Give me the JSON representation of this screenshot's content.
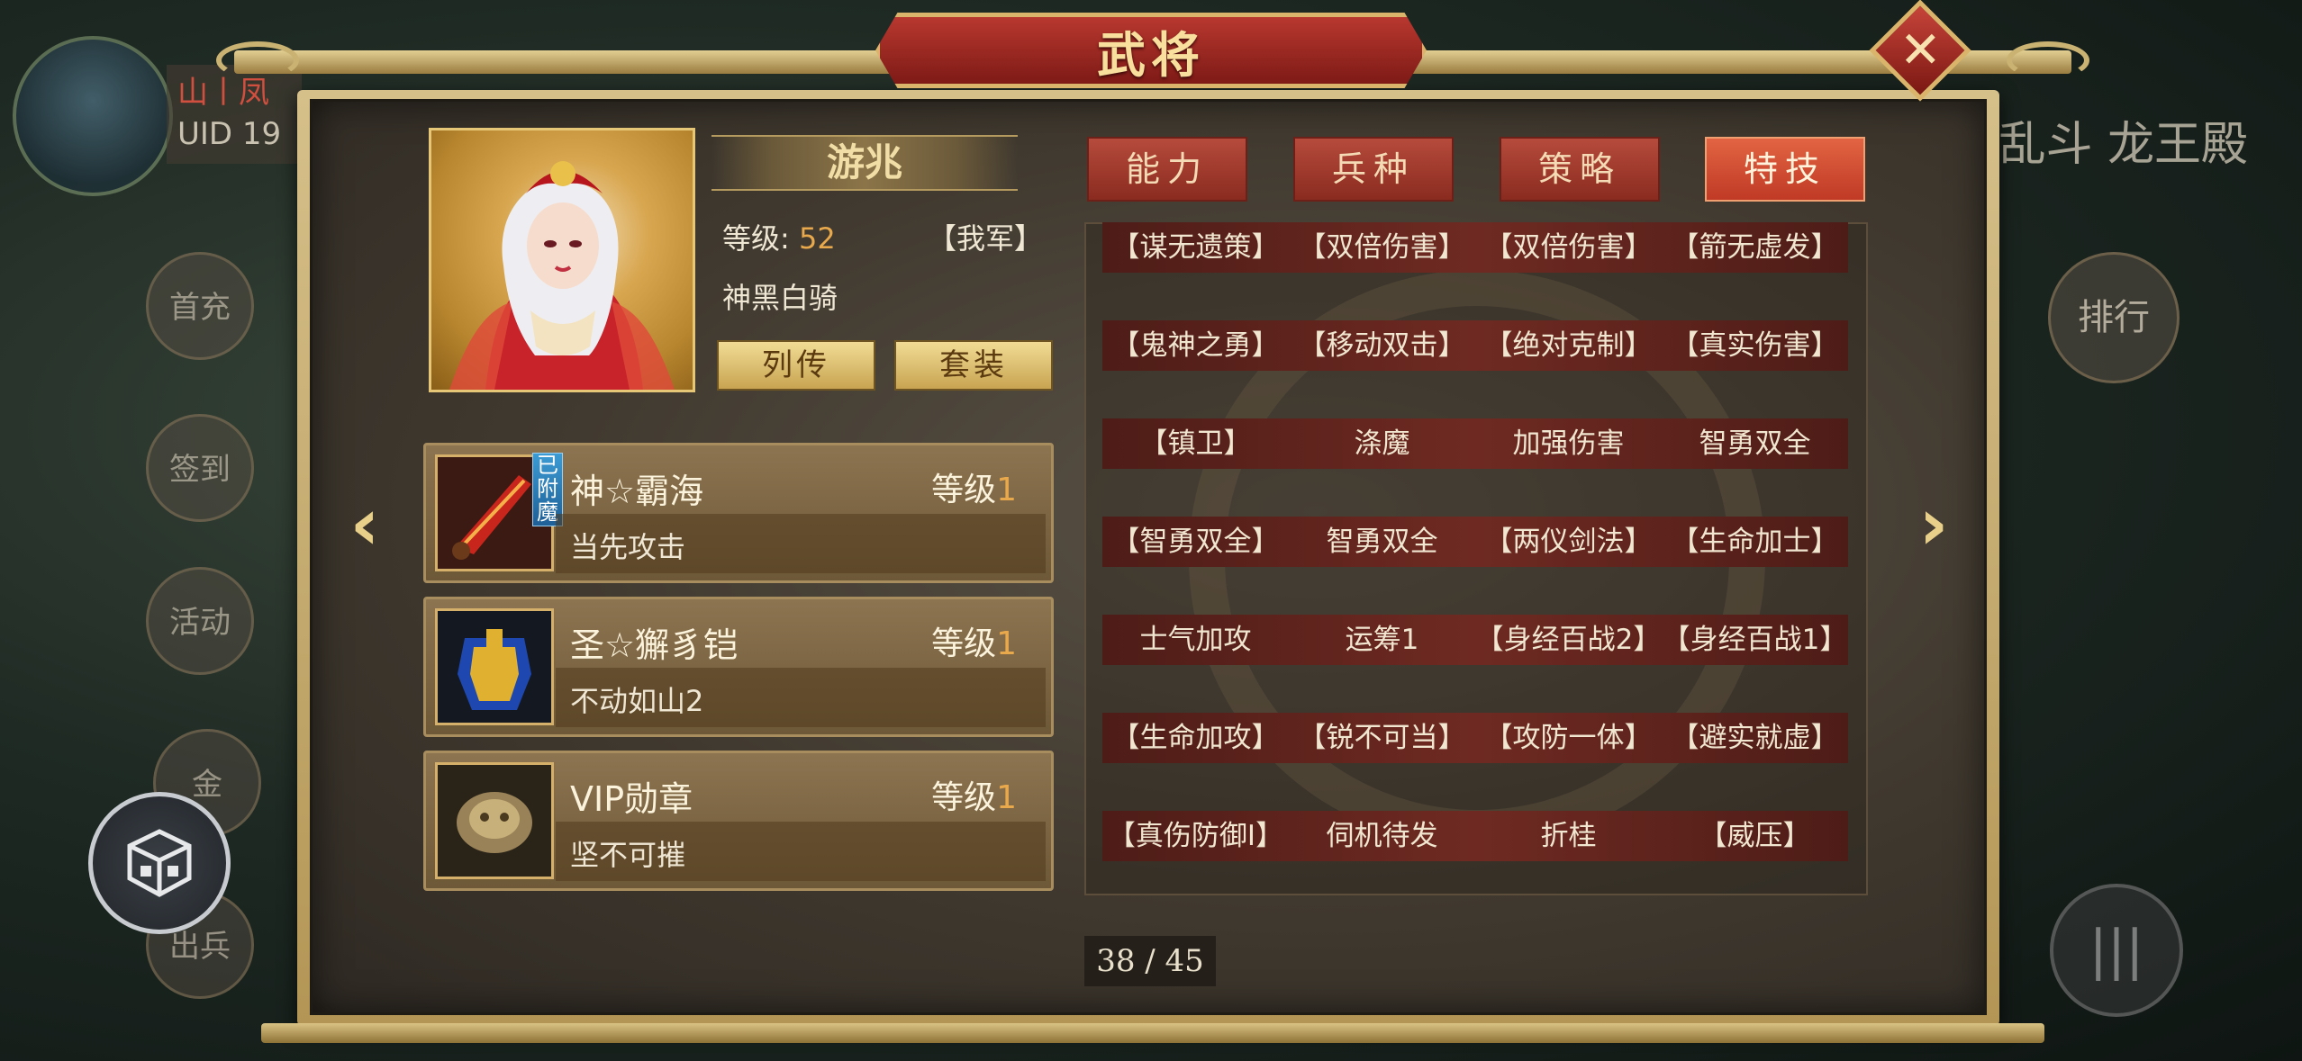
{
  "background": {
    "player_tag": {
      "line1": "山丨凤",
      "line2": "UID 19"
    },
    "side_buttons": [
      "首充",
      "签到",
      "活动",
      "金",
      "出兵"
    ],
    "right_title": "乱斗 龙王殿",
    "rank_label": "排行"
  },
  "dialog": {
    "title": "武将",
    "close_symbol": "✕"
  },
  "hero": {
    "name": "游兆",
    "level_label": "等级:",
    "level_value": "52",
    "faction": "【我军】",
    "unit_type": "神黑白骑",
    "biography_button": "列传",
    "outfit_button": "套装"
  },
  "equipment": [
    {
      "name": "神☆霸海",
      "level_label": "等级",
      "level_value": "1",
      "desc": "当先攻击",
      "badge": "已附魔",
      "icon": "red-blade-weapon-icon"
    },
    {
      "name": "圣☆獬豸铠",
      "level_label": "等级",
      "level_value": "1",
      "desc": "不动如山2",
      "icon": "blue-armor-icon"
    },
    {
      "name": "VIP勋章",
      "level_label": "等级",
      "level_value": "1",
      "desc": "坚不可摧",
      "icon": "bronze-medal-icon"
    }
  ],
  "tabs": [
    {
      "label": "能力",
      "active": false
    },
    {
      "label": "兵种",
      "active": false
    },
    {
      "label": "策略",
      "active": false
    },
    {
      "label": "特技",
      "active": true
    }
  ],
  "skills": [
    [
      "【谋无遗策】",
      "【双倍伤害】",
      "【双倍伤害】",
      "【箭无虚发】"
    ],
    [
      "【鬼神之勇】",
      "【移动双击】",
      "【绝对克制】",
      "【真实伤害】"
    ],
    [
      "【镇卫】",
      "涤魔",
      "加强伤害",
      "智勇双全"
    ],
    [
      "【智勇双全】",
      "智勇双全",
      "【两仪剑法】",
      "【生命加士】"
    ],
    [
      "士气加攻",
      "运筹1",
      "【身经百战2】",
      "【身经百战1】"
    ],
    [
      "【生命加攻】",
      "【锐不可当】",
      "【攻防一体】",
      "【避实就虚】"
    ],
    [
      "【真伤防御Ⅰ】",
      "伺机待发",
      "折桂",
      "【威压】"
    ]
  ],
  "pager": "38 / 45",
  "colors": {
    "accent_gold": "#e8a84c",
    "active_tab": "#e26443",
    "tab": "#b64b3c",
    "skill_row": "#6e2a22"
  }
}
